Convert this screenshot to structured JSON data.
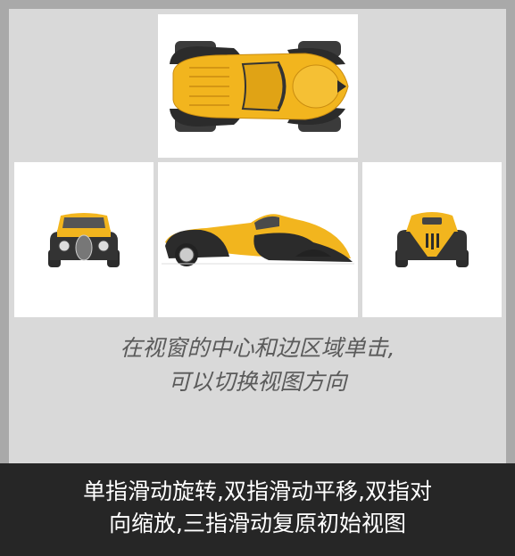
{
  "views": {
    "top": {
      "label": "top-view",
      "icon": "car-top-view-icon"
    },
    "front": {
      "label": "front-view",
      "icon": "car-front-view-icon"
    },
    "side": {
      "label": "side-view",
      "icon": "car-side-view-icon"
    },
    "rear": {
      "label": "rear-view",
      "icon": "car-rear-view-icon"
    }
  },
  "hint": {
    "line1": "在视窗的中心和边区域单击,",
    "line2": "可以切换视图方向"
  },
  "footer": {
    "line1": "单指滑动旋转,双指滑动平移,双指对",
    "line2": "向缩放,三指滑动复原初始视图"
  },
  "colors": {
    "body_yellow": "#f2b51e",
    "fender_black": "#2b2b2b",
    "background": "#d9d9d9",
    "footer_bg": "#262626"
  }
}
